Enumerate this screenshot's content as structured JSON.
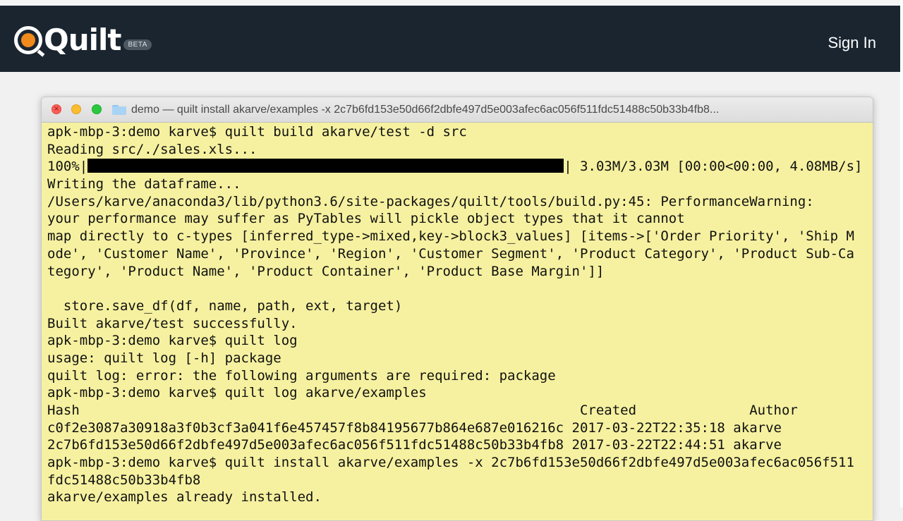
{
  "navbar": {
    "logo_text": "Quilt",
    "beta_label": "BETA",
    "sign_in_label": "Sign In"
  },
  "window": {
    "title": "demo — quilt install akarve/examples -x 2c7b6fd153e50d66f2dbfe497d5e003afec6ac056f511fdc51488c50b33b4fb8..."
  },
  "terminal": {
    "lines": [
      "apk-mbp-3:demo karve$ quilt build akarve/test -d src",
      "Reading src/./sales.xls...",
      "",
      "Writing the dataframe...",
      "/Users/karve/anaconda3/lib/python3.6/site-packages/quilt/tools/build.py:45: PerformanceWarning:",
      "your performance may suffer as PyTables will pickle object types that it cannot",
      "map directly to c-types [inferred_type->mixed,key->block3_values] [items->['Order Priority', 'Ship M",
      "ode', 'Customer Name', 'Province', 'Region', 'Customer Segment', 'Product Category', 'Product Sub-Ca",
      "tegory', 'Product Name', 'Product Container', 'Product Base Margin']]",
      "",
      "  store.save_df(df, name, path, ext, target)",
      "Built akarve/test successfully.",
      "apk-mbp-3:demo karve$ quilt log",
      "usage: quilt log [-h] package",
      "quilt log: error: the following arguments are required: package",
      "apk-mbp-3:demo karve$ quilt log akarve/examples",
      "Hash                                                              Created              Author",
      "c0f2e3087a30918a3f0b3cf3a041f6e457457f8b84195677b864e687e016216c 2017-03-22T22:35:18 akarve",
      "2c7b6fd153e50d66f2dbfe497d5e003afec6ac056f511fdc51488c50b33b4fb8 2017-03-22T22:44:51 akarve",
      "apk-mbp-3:demo karve$ quilt install akarve/examples -x 2c7b6fd153e50d66f2dbfe497d5e003afec6ac056f511",
      "fdc51488c50b33b4fb8",
      "akarve/examples already installed."
    ],
    "progress": {
      "percent_label": "100%|",
      "percent": 100,
      "suffix": "| 3.03M/3.03M [00:00<00:00, 4.08MB/s]"
    }
  }
}
